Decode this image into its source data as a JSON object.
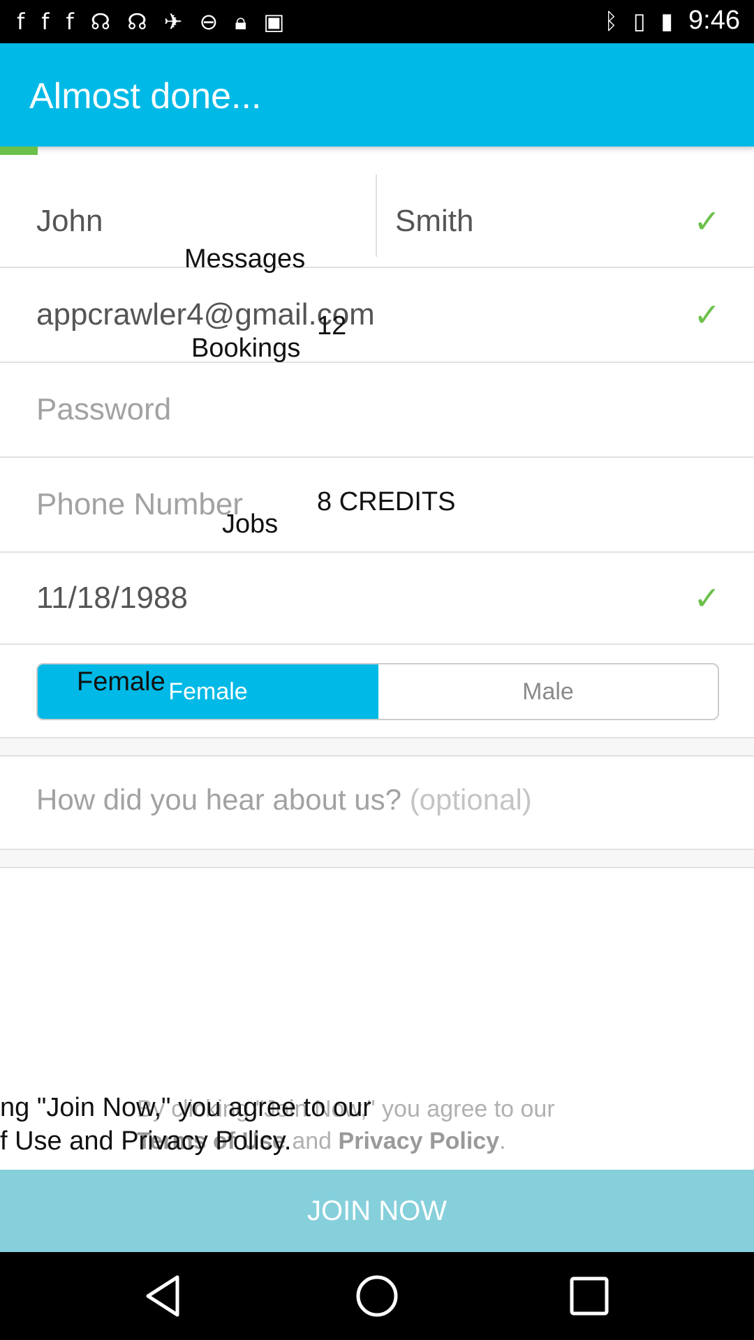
{
  "status_bar": {
    "time": "9:46",
    "icons": [
      "facebook-icon",
      "facebook-icon",
      "facebook-icon",
      "signal-app-icon",
      "signal-app-icon",
      "fake-gps-icon",
      "block-icon",
      "lock-icon",
      "android-icon"
    ],
    "right_icons": [
      "bluetooth-icon",
      "vibrate-icon",
      "battery-icon"
    ]
  },
  "app_bar": {
    "title": "Almost done..."
  },
  "form": {
    "first_name": "John",
    "last_name": "Smith",
    "email": "appcrawler4@gmail.com",
    "password_placeholder": "Password",
    "phone_placeholder": "Phone Number",
    "birthdate": "11/18/1988",
    "gender_female": "Female",
    "gender_male": "Male",
    "referral_placeholder": "How did you hear about us?",
    "referral_optional": "(optional)"
  },
  "terms": {
    "prefix": "By clicking \"Join Now,\" you agree to our",
    "terms_link": "Terms of Use",
    "conjunction": "and",
    "privacy_link": "Privacy Policy",
    "suffix": "."
  },
  "join_button": {
    "label": "JOIN NOW"
  },
  "overlay": {
    "messages": "Messages",
    "count": "12",
    "bookings": "Bookings",
    "credits": "8 CREDITS",
    "jobs": "Jobs",
    "female": "Female",
    "terms_line1": "ng \"Join Now,\" you agree to our",
    "terms_line2": "f Use and Privacy Policy."
  },
  "colors": {
    "primary": "#00b9e6",
    "check": "#6cc04a",
    "join_button": "#86d0dc"
  }
}
